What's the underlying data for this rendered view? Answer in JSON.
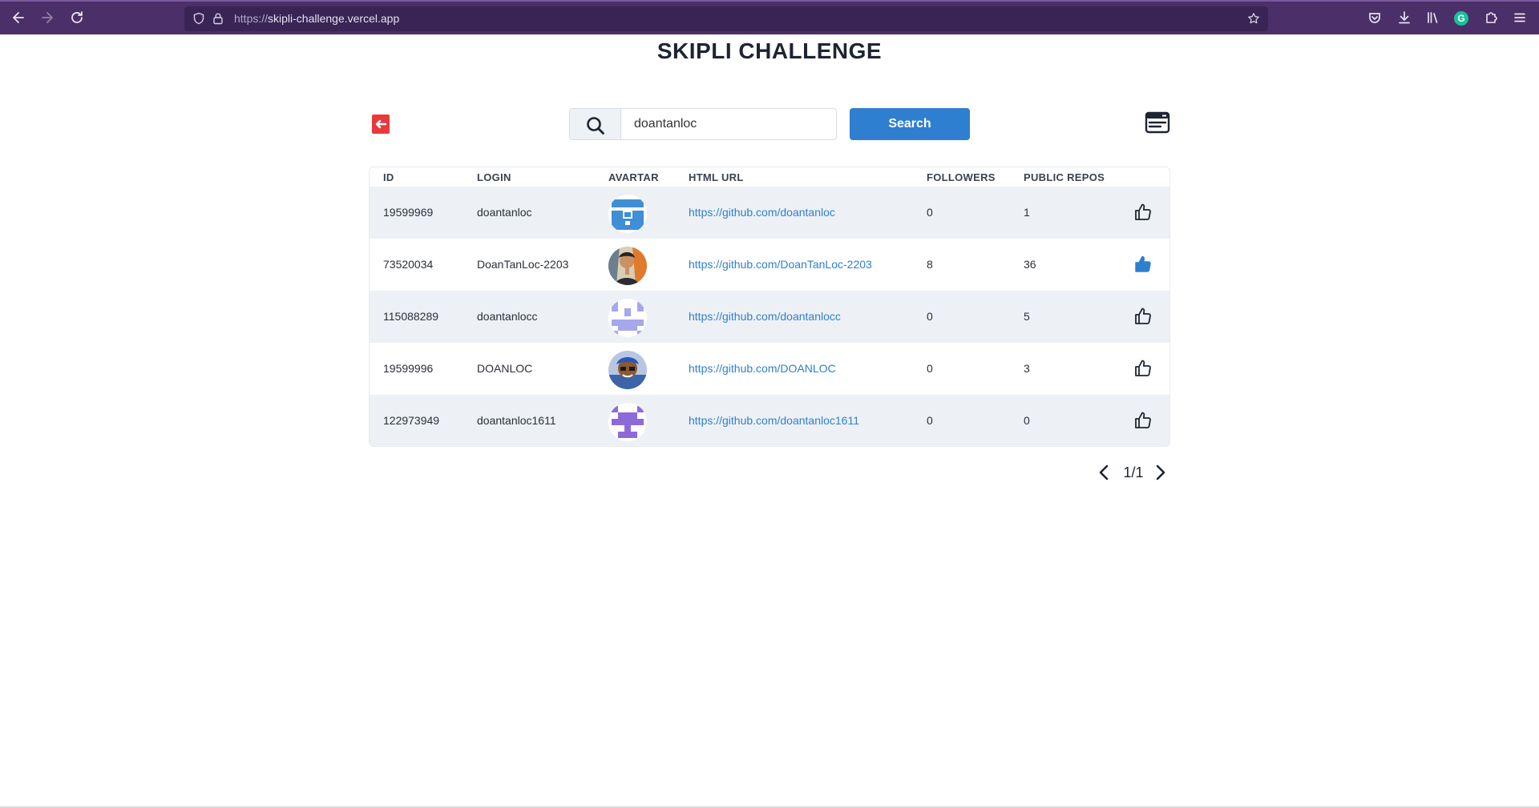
{
  "browser": {
    "url_prefix": "https://",
    "url_host": "skipli-challenge.vercel.app"
  },
  "page": {
    "title": "SKIPLI CHALLENGE"
  },
  "search": {
    "value": "doantanloc",
    "button_label": "Search"
  },
  "table": {
    "headers": {
      "id": "ID",
      "login": "LOGIN",
      "avatar": "AVARTAR",
      "html_url": "HTML URL",
      "followers": "FOLLOWERS",
      "public_repos": "PUBLIC REPOS"
    },
    "rows": [
      {
        "id": "19599969",
        "login": "doantanloc",
        "html_url": "https://github.com/doantanloc",
        "followers": "0",
        "public_repos": "1",
        "liked": false,
        "avatar": "identicon-blue"
      },
      {
        "id": "73520034",
        "login": "DoanTanLoc-2203",
        "html_url": "https://github.com/DoanTanLoc-2203",
        "followers": "8",
        "public_repos": "36",
        "liked": true,
        "avatar": "photo-portrait"
      },
      {
        "id": "115088289",
        "login": "doantanlocc",
        "html_url": "https://github.com/doantanlocc",
        "followers": "0",
        "public_repos": "5",
        "liked": false,
        "avatar": "identicon-lavender"
      },
      {
        "id": "19599996",
        "login": "DOANLOC",
        "html_url": "https://github.com/DOANLOC",
        "followers": "0",
        "public_repos": "3",
        "liked": false,
        "avatar": "photo-cartoon"
      },
      {
        "id": "122973949",
        "login": "doantanloc1611",
        "html_url": "https://github.com/doantanloc1611",
        "followers": "0",
        "public_repos": "0",
        "liked": false,
        "avatar": "identicon-purple"
      }
    ]
  },
  "pagination": {
    "text": "1/1"
  },
  "colors": {
    "accent": "#2f7fd0",
    "logout": "#e8393b",
    "row_alt": "#edf1f5",
    "browser_chrome": "#4a2f68"
  },
  "icons": [
    "back-arrow-icon",
    "forward-arrow-icon",
    "reload-icon",
    "shield-icon",
    "lock-icon",
    "star-icon",
    "pocket-icon",
    "download-icon",
    "library-icon",
    "grammarly-icon",
    "extensions-icon",
    "menu-icon",
    "logout-icon",
    "search-icon",
    "liked-list-icon",
    "thumbs-up-icon",
    "chevron-left-icon",
    "chevron-right-icon"
  ]
}
